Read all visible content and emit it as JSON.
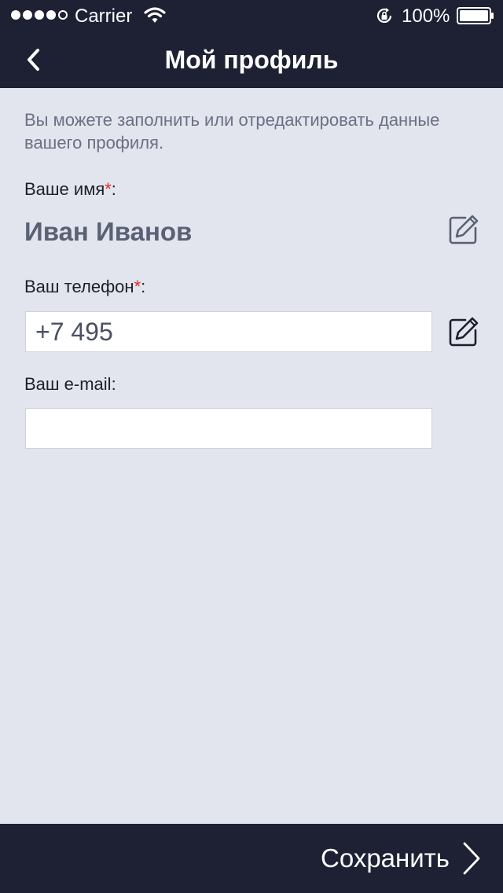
{
  "status_bar": {
    "carrier": "Carrier",
    "battery_percent": "100%",
    "icons": [
      "signal-dots",
      "wifi-icon",
      "rotation-lock-icon",
      "battery-icon"
    ]
  },
  "nav": {
    "title": "Мой профиль",
    "back_icon": "chevron-left-icon"
  },
  "intro_text": "Вы можете заполнить или отредактировать данные вашего профиля.",
  "fields": {
    "name": {
      "label": "Ваше имя",
      "required_mark": "*",
      "suffix": ":",
      "value": "Иван Иванов",
      "edit_icon": "edit-icon"
    },
    "phone": {
      "label": "Ваш телефон",
      "required_mark": "*",
      "suffix": ":",
      "value": "+7 495",
      "edit_icon": "edit-icon"
    },
    "email": {
      "label": "Ваш e-mail",
      "suffix": ":",
      "value": ""
    }
  },
  "footer": {
    "save_label": "Сохранить",
    "save_icon": "chevron-right-icon"
  },
  "colors": {
    "header_bg": "#1d2133",
    "page_bg": "#e2e4ee",
    "required": "#e02a2a",
    "muted_text": "#6a7183"
  }
}
